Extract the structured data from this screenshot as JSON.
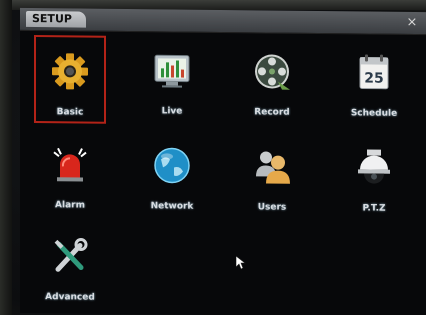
{
  "window": {
    "title": "SETUP",
    "close_symbol": "×"
  },
  "menu": {
    "items": [
      {
        "label": "Basic",
        "icon": "gear-icon",
        "selected": true
      },
      {
        "label": "Live",
        "icon": "monitor-chart-icon"
      },
      {
        "label": "Record",
        "icon": "film-reel-icon"
      },
      {
        "label": "Schedule",
        "icon": "calendar-icon",
        "calendar_day": "25"
      },
      {
        "label": "Alarm",
        "icon": "alarm-siren-icon"
      },
      {
        "label": "Network",
        "icon": "globe-icon"
      },
      {
        "label": "Users",
        "icon": "users-icon"
      },
      {
        "label": "P.T.Z",
        "icon": "dome-camera-icon"
      },
      {
        "label": "Advanced",
        "icon": "tools-icon"
      }
    ]
  },
  "colors": {
    "selection_border": "#b32318",
    "label_text": "#d9dde2",
    "titlebar": "#4a4d51"
  }
}
